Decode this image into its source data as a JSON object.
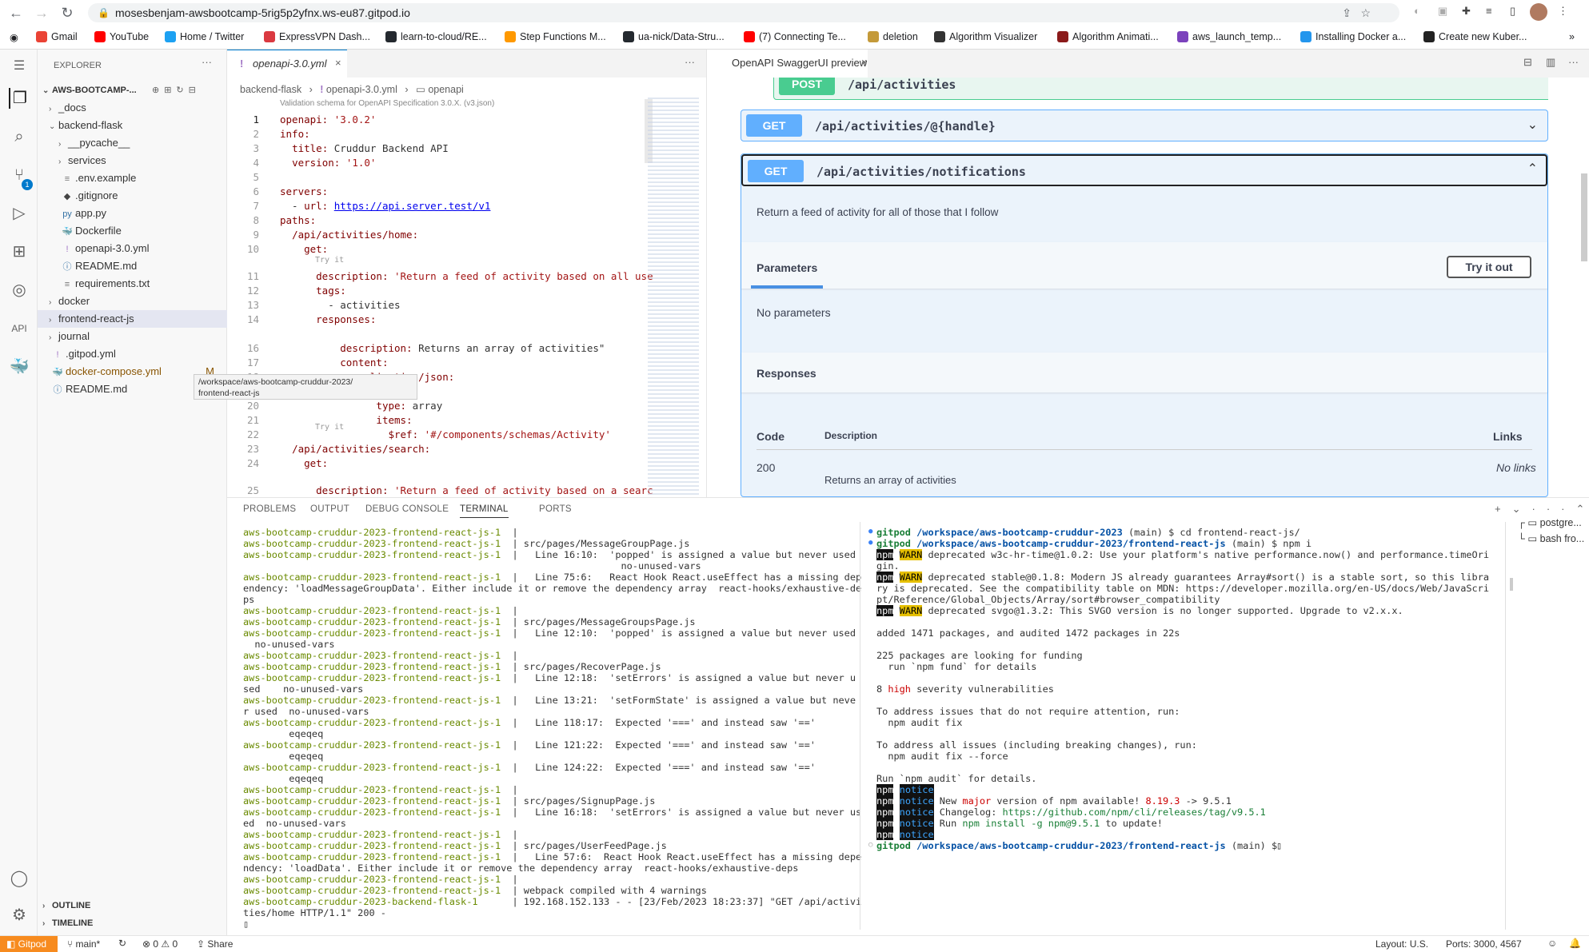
{
  "browser": {
    "url": "mosesbenjam-awsbootcamp-5rig5p2yfnx.ws-eu87.gitpod.io",
    "bookmarks": [
      "Gmail",
      "YouTube",
      "Home / Twitter",
      "ExpressVPN Dash...",
      "learn-to-cloud/RE...",
      "Step Functions M...",
      "ua-nick/Data-Stru...",
      "(7) Connecting Te...",
      "deletion",
      "Algorithm Visualizer",
      "Algorithm Animati...",
      "aws_launch_temp...",
      "Installing Docker a...",
      "Create new Kuber..."
    ],
    "bookmark_colors": [
      "#ea4335",
      "#ff0000",
      "#1da1f2",
      "#da3940",
      "#24292f",
      "#ff9900",
      "#24292f",
      "#ff0000",
      "#c49a3a",
      "#333333",
      "#8b1a1a",
      "#7b42bc",
      "#2496ed",
      "#222222"
    ]
  },
  "explorer": {
    "title": "EXPLORER",
    "root": "AWS-BOOTCAMP-...",
    "items": [
      {
        "label": "_docs",
        "kind": "folder",
        "open": false,
        "depth": 1
      },
      {
        "label": "backend-flask",
        "kind": "folder",
        "open": true,
        "depth": 1
      },
      {
        "label": "__pycache__",
        "kind": "folder",
        "open": false,
        "depth": 2
      },
      {
        "label": "services",
        "kind": "folder",
        "open": false,
        "depth": 2
      },
      {
        "label": ".env.example",
        "kind": "file",
        "icon": "≡",
        "depth": 2
      },
      {
        "label": ".gitignore",
        "kind": "file",
        "icon": "◆",
        "depth": 2
      },
      {
        "label": "app.py",
        "kind": "file",
        "icon": "py",
        "depth": 2
      },
      {
        "label": "Dockerfile",
        "kind": "file",
        "icon": "🐳",
        "depth": 2
      },
      {
        "label": "openapi-3.0.yml",
        "kind": "file",
        "icon": "!",
        "depth": 2
      },
      {
        "label": "README.md",
        "kind": "file",
        "icon": "ⓘ",
        "depth": 2
      },
      {
        "label": "requirements.txt",
        "kind": "file",
        "icon": "≡",
        "depth": 2
      },
      {
        "label": "docker",
        "kind": "folder",
        "open": false,
        "depth": 1
      },
      {
        "label": "frontend-react-js",
        "kind": "folder",
        "open": false,
        "depth": 1
      },
      {
        "label": "journal",
        "kind": "folder",
        "open": false,
        "depth": 1
      },
      {
        "label": ".gitpod.yml",
        "kind": "file",
        "icon": "!",
        "depth": 1
      },
      {
        "label": "docker-compose.yml",
        "kind": "file",
        "icon": "🐳",
        "depth": 1,
        "badge": "M"
      },
      {
        "label": "README.md",
        "kind": "file",
        "icon": "ⓘ",
        "depth": 1
      }
    ],
    "tooltip_line1": "/workspace/aws-bootcamp-cruddur-2023/",
    "tooltip_line2": "frontend-react-js",
    "outline": "OUTLINE",
    "timeline": "TIMELINE"
  },
  "editor": {
    "tab": "openapi-3.0.yml",
    "breadcrumb": [
      "backend-flask",
      "openapi-3.0.yml",
      "openapi"
    ],
    "schema_hint": "Validation schema for OpenAPI Specification 3.0.X. (v3.json)",
    "codelens": "Try it",
    "lines": [
      {
        "n": "1",
        "t": "openapi: '3.0.2'"
      },
      {
        "n": "2",
        "t": "info:"
      },
      {
        "n": "3",
        "t": "  title: Cruddur Backend API"
      },
      {
        "n": "4",
        "t": "  version: '1.0'"
      },
      {
        "n": "5",
        "t": ""
      },
      {
        "n": "6",
        "t": "servers:"
      },
      {
        "n": "7",
        "t": "  - url: https://api.server.test/v1"
      },
      {
        "n": "8",
        "t": "paths:"
      },
      {
        "n": "9",
        "t": "  /api/activities/home:"
      },
      {
        "n": "10",
        "t": "    get:"
      },
      {
        "n": "11",
        "t": "      description: 'Return a feed of activity based on all use"
      },
      {
        "n": "12",
        "t": "      tags:"
      },
      {
        "n": "13",
        "t": "        - activities"
      },
      {
        "n": "14",
        "t": "      responses:"
      },
      {
        "n": "16",
        "t": "          description: Returns an array of activities\""
      },
      {
        "n": "17",
        "t": "          content:"
      },
      {
        "n": "18",
        "t": "            application/json:"
      },
      {
        "n": "19",
        "t": "              schema:"
      },
      {
        "n": "20",
        "t": "                type: array"
      },
      {
        "n": "21",
        "t": "                items:"
      },
      {
        "n": "22",
        "t": "                  $ref: '#/components/schemas/Activity'"
      },
      {
        "n": "23",
        "t": "  /api/activities/search:"
      },
      {
        "n": "24",
        "t": "    get:"
      },
      {
        "n": "25",
        "t": "      description: 'Return a feed of activity based on a searc"
      }
    ]
  },
  "preview": {
    "tab": "OpenAPI SwaggerUI preview",
    "ops": [
      {
        "method": "POST",
        "path": "/api/activities"
      },
      {
        "method": "GET",
        "path": "/api/activities/@{handle}"
      },
      {
        "method": "GET",
        "path": "/api/activities/notifications"
      }
    ],
    "op_description": "Return a feed of activity for all of those that I follow",
    "parameters_title": "Parameters",
    "try_button": "Try it out",
    "no_params": "No parameters",
    "responses_title": "Responses",
    "col_code": "Code",
    "col_desc": "Description",
    "col_links": "Links",
    "resp_code": "200",
    "resp_desc": "Returns an array of activities",
    "resp_links": "No links"
  },
  "panel": {
    "tabs": [
      "PROBLEMS",
      "OUTPUT",
      "DEBUG CONSOLE",
      "TERMINAL",
      "PORTS"
    ],
    "active_tab": "TERMINAL",
    "left_lines": [
      "aws-bootcamp-cruddur-2023-frontend-react-js-1  |",
      "aws-bootcamp-cruddur-2023-frontend-react-js-1  | src/pages/MessageGroupPage.js",
      "aws-bootcamp-cruddur-2023-frontend-react-js-1  |   Line 16:10:  'popped' is assigned a value but never used",
      "                                                                  no-unused-vars",
      "aws-bootcamp-cruddur-2023-frontend-react-js-1  |   Line 75:6:   React Hook React.useEffect has a missing dep",
      "endency: 'loadMessageGroupData'. Either include it or remove the dependency array  react-hooks/exhaustive-de",
      "ps",
      "aws-bootcamp-cruddur-2023-frontend-react-js-1  |",
      "aws-bootcamp-cruddur-2023-frontend-react-js-1  | src/pages/MessageGroupsPage.js",
      "aws-bootcamp-cruddur-2023-frontend-react-js-1  |   Line 12:10:  'popped' is assigned a value but never used",
      "  no-unused-vars",
      "aws-bootcamp-cruddur-2023-frontend-react-js-1  |",
      "aws-bootcamp-cruddur-2023-frontend-react-js-1  | src/pages/RecoverPage.js",
      "aws-bootcamp-cruddur-2023-frontend-react-js-1  |   Line 12:18:  'setErrors' is assigned a value but never u",
      "sed    no-unused-vars",
      "aws-bootcamp-cruddur-2023-frontend-react-js-1  |   Line 13:21:  'setFormState' is assigned a value but neve",
      "r used  no-unused-vars",
      "aws-bootcamp-cruddur-2023-frontend-react-js-1  |   Line 118:17:  Expected '===' and instead saw '=='",
      "        eqeqeq",
      "aws-bootcamp-cruddur-2023-frontend-react-js-1  |   Line 121:22:  Expected '===' and instead saw '=='",
      "        eqeqeq",
      "aws-bootcamp-cruddur-2023-frontend-react-js-1  |   Line 124:22:  Expected '===' and instead saw '=='",
      "        eqeqeq",
      "aws-bootcamp-cruddur-2023-frontend-react-js-1  |",
      "aws-bootcamp-cruddur-2023-frontend-react-js-1  | src/pages/SignupPage.js",
      "aws-bootcamp-cruddur-2023-frontend-react-js-1  |   Line 16:18:  'setErrors' is assigned a value but never us",
      "ed  no-unused-vars",
      "aws-bootcamp-cruddur-2023-frontend-react-js-1  |",
      "aws-bootcamp-cruddur-2023-frontend-react-js-1  | src/pages/UserFeedPage.js",
      "aws-bootcamp-cruddur-2023-frontend-react-js-1  |   Line 57:6:  React Hook React.useEffect has a missing depe",
      "ndency: 'loadData'. Either include it or remove the dependency array  react-hooks/exhaustive-deps",
      "aws-bootcamp-cruddur-2023-frontend-react-js-1  |",
      "aws-bootcamp-cruddur-2023-frontend-react-js-1  | webpack compiled with 4 warnings",
      "aws-bootcamp-cruddur-2023-backend-flask-1      | 192.168.152.133 - - [23/Feb/2023 18:23:37] \"GET /api/activi",
      "ties/home HTTP/1.1\" 200 -"
    ],
    "right_lines": [
      "gitpod /workspace/aws-bootcamp-cruddur-2023 (main) $ cd frontend-react-js/",
      "gitpod /workspace/aws-bootcamp-cruddur-2023/frontend-react-js (main) $ npm i",
      "npm WARN deprecated w3c-hr-time@1.0.2: Use your platform's native performance.now() and performance.timeOri",
      "gin.",
      "npm WARN deprecated stable@0.1.8: Modern JS already guarantees Array#sort() is a stable sort, so this libra",
      "ry is deprecated. See the compatibility table on MDN: https://developer.mozilla.org/en-US/docs/Web/JavaScri",
      "pt/Reference/Global_Objects/Array/sort#browser_compatibility",
      "npm WARN deprecated svgo@1.3.2: This SVGO version is no longer supported. Upgrade to v2.x.x.",
      "",
      "added 1471 packages, and audited 1472 packages in 22s",
      "",
      "225 packages are looking for funding",
      "  run `npm fund` for details",
      "",
      "8 high severity vulnerabilities",
      "",
      "To address issues that do not require attention, run:",
      "  npm audit fix",
      "",
      "To address all issues (including breaking changes), run:",
      "  npm audit fix --force",
      "",
      "Run `npm audit` for details.",
      "npm notice",
      "npm notice New major version of npm available! 8.19.3 -> 9.5.1",
      "npm notice Changelog: https://github.com/npm/cli/releases/tag/v9.5.1",
      "npm notice Run npm install -g npm@9.5.1 to update!",
      "npm notice",
      "gitpod /workspace/aws-bootcamp-cruddur-2023/frontend-react-js (main) $ "
    ],
    "terminals": [
      "postgre...",
      "bash fro..."
    ]
  },
  "status": {
    "gitpod": "Gitpod",
    "branch": "main*",
    "errors": "0",
    "warnings": "0",
    "share": "Share",
    "layout": "Layout: U.S.",
    "ports": "Ports: 3000, 4567"
  }
}
